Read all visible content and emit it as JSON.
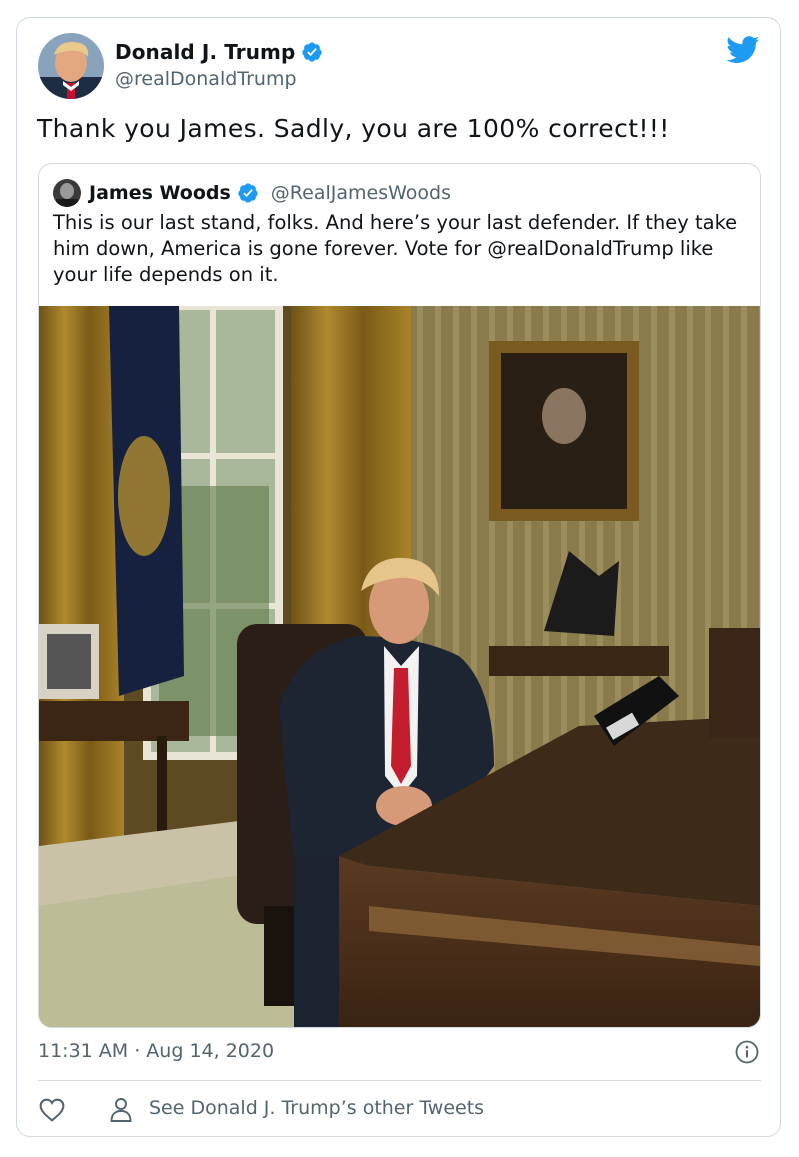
{
  "tweet": {
    "author_name": "Donald J. Trump",
    "author_handle": "@realDonaldTrump",
    "text": "Thank you James. Sadly, you are 100% correct!!!",
    "timestamp": "11:31 AM · Aug 14, 2020",
    "see_other": "See Donald J. Trump’s other Tweets"
  },
  "quoted": {
    "author_name": "James Woods",
    "author_handle": "@RealJamesWoods",
    "text": "This is our last stand, folks. And here’s your last defender. If they take him down, America is gone forever. Vote for @realDonaldTrump like your life depends on it."
  },
  "icons": {
    "brand": "twitter-bird-icon",
    "verified": "verified-badge-icon",
    "info": "info-icon",
    "like": "heart-icon",
    "profile": "person-icon"
  },
  "colors": {
    "brand_blue": "#1d9bf0",
    "text_primary": "#0f1419",
    "text_secondary": "#536471",
    "border": "#cfd9de"
  }
}
